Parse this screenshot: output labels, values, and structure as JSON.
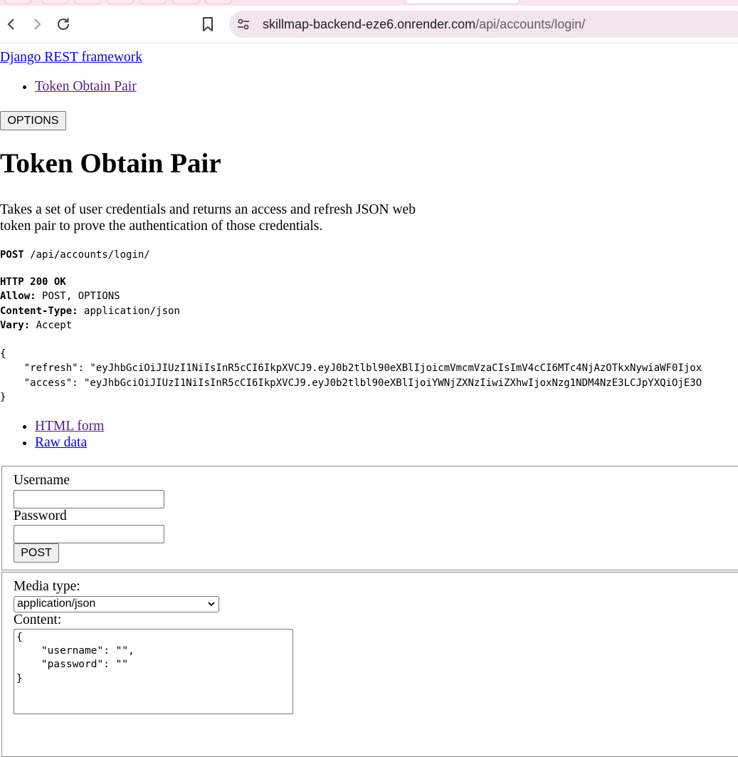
{
  "browser": {
    "url_host": "skillmap-backend-eze6.onrender.com",
    "url_path": "/api/accounts/login/",
    "icons": [
      "back-arrow-icon",
      "forward-arrow-icon",
      "reload-icon",
      "bookmark-icon",
      "site-settings-icon"
    ]
  },
  "page": {
    "brand": "Django REST framework",
    "breadcrumb": "Token Obtain Pair",
    "options_button": "OPTIONS",
    "title": "Token Obtain Pair",
    "description": "Takes a set of user credentials and returns an access and refresh JSON web token pair to prove the authentication of those credentials.",
    "request": {
      "method": "POST",
      "path": "/api/accounts/login/"
    },
    "response": {
      "status": "HTTP 200 OK",
      "headers": [
        {
          "name": "Allow:",
          "value": "POST, OPTIONS"
        },
        {
          "name": "Content-Type:",
          "value": "application/json"
        },
        {
          "name": "Vary:",
          "value": "Accept"
        }
      ],
      "body_open": "{",
      "body_lines": [
        "    \"refresh\": \"eyJhbGciOiJIUzI1NiIsInR5cCI6IkpXVCJ9.eyJ0b2tlbl90eXBlIjoicmVmcmVzaCIsImV4cCI6MTc4NjAzOTkxNywiaWF0Ijox",
        "    \"access\": \"eyJhbGciOiJIUzI1NiIsInR5cCI6IkpXVCJ9.eyJ0b2tlbl90eXBlIjoiYWNjZXNzIiwiZXhwIjoxNzg1NDM4NzE3LCJpYXQiOjE3O"
      ],
      "body_close": "}"
    },
    "format_links": [
      "HTML form",
      "Raw data"
    ],
    "form": {
      "username_label": "Username",
      "username_value": "",
      "password_label": "Password",
      "password_value": "",
      "post_button": "POST"
    },
    "raw_form": {
      "media_type_label": "Media type:",
      "media_type_value": "application/json",
      "content_label": "Content:",
      "content_value": "{\n    \"username\": \"\",\n    \"password\": \"\"\n}"
    }
  },
  "colors": {
    "link": "#0000ee",
    "visited_link": "#551a8b",
    "omnibox_bg": "#f3e5ee",
    "tabstrip_bg": "#fce4f0"
  }
}
